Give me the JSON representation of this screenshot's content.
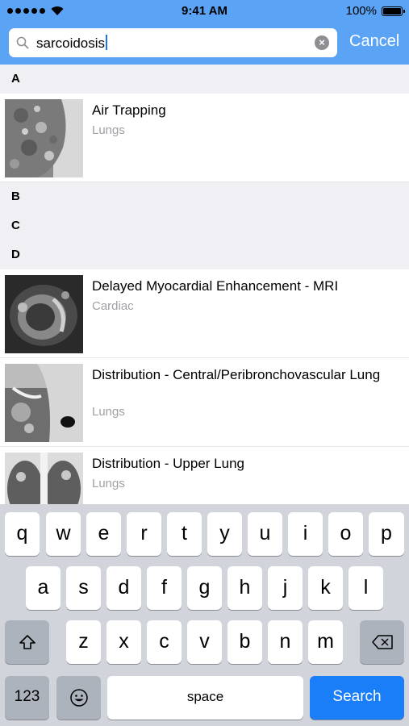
{
  "status": {
    "time": "9:41 AM",
    "battery": "100%"
  },
  "search": {
    "query": "sarcoidosis",
    "cancel_label": "Cancel"
  },
  "sections": [
    {
      "letter": "A"
    },
    {
      "letter": "B"
    },
    {
      "letter": "C"
    },
    {
      "letter": "D"
    }
  ],
  "items": [
    {
      "title": "Air Trapping",
      "category": "Lungs"
    },
    {
      "title": "Delayed Myocardial Enhancement - MRI",
      "category": "Cardiac"
    },
    {
      "title": "Distribution - Central/Peribronchovascular Lung",
      "category": "Lungs"
    },
    {
      "title": "Distribution - Upper Lung",
      "category": "Lungs"
    }
  ],
  "keyboard": {
    "row1": [
      "q",
      "w",
      "e",
      "r",
      "t",
      "y",
      "u",
      "i",
      "o",
      "p"
    ],
    "row2": [
      "a",
      "s",
      "d",
      "f",
      "g",
      "h",
      "j",
      "k",
      "l"
    ],
    "row3": [
      "z",
      "x",
      "c",
      "v",
      "b",
      "n",
      "m"
    ],
    "numbers_label": "123",
    "space_label": "space",
    "return_label": "Search"
  }
}
